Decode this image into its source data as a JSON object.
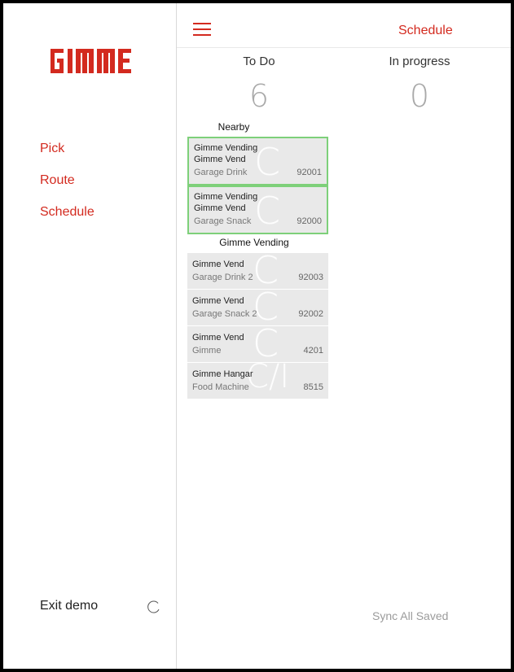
{
  "app": {
    "logo_text": "GIMME",
    "brand_color": "#d32a1f",
    "title": "Schedule"
  },
  "sidebar": {
    "items": [
      {
        "label": "Pick"
      },
      {
        "label": "Route"
      },
      {
        "label": "Schedule"
      }
    ],
    "exit_label": "Exit demo",
    "refresh_icon": "refresh-icon"
  },
  "columns": {
    "todo": {
      "label": "To Do",
      "count": "6"
    },
    "inprogress": {
      "label": "In progress",
      "count": "0"
    }
  },
  "sections": {
    "nearby": "Nearby",
    "group": "Gimme Vending"
  },
  "cards": [
    {
      "line1": "Gimme Vending",
      "line2": "Gimme Vend",
      "line3": "Garage Drink",
      "number": "92001",
      "watermark": "C"
    },
    {
      "line1": "Gimme Vending",
      "line2": "Gimme Vend",
      "line3": "Garage Snack",
      "number": "92000",
      "watermark": "C"
    },
    {
      "line1": "Gimme Vend",
      "line3": "Garage Drink 2",
      "number": "92003",
      "watermark": "C"
    },
    {
      "line1": "Gimme Vend",
      "line3": "Garage Snack 2",
      "number": "92002",
      "watermark": "C"
    },
    {
      "line1": "Gimme Vend",
      "line3": "Gimme",
      "number": "4201",
      "watermark": "C"
    },
    {
      "line1": "Gimme Hangar",
      "line3": "Food Machine",
      "number": "8515",
      "watermark": "C/I"
    }
  ],
  "footer": {
    "sync_status": "Sync All Saved"
  },
  "colors": {
    "nearby_border": "#7ed07a",
    "card_bg": "#e9e9e9"
  }
}
